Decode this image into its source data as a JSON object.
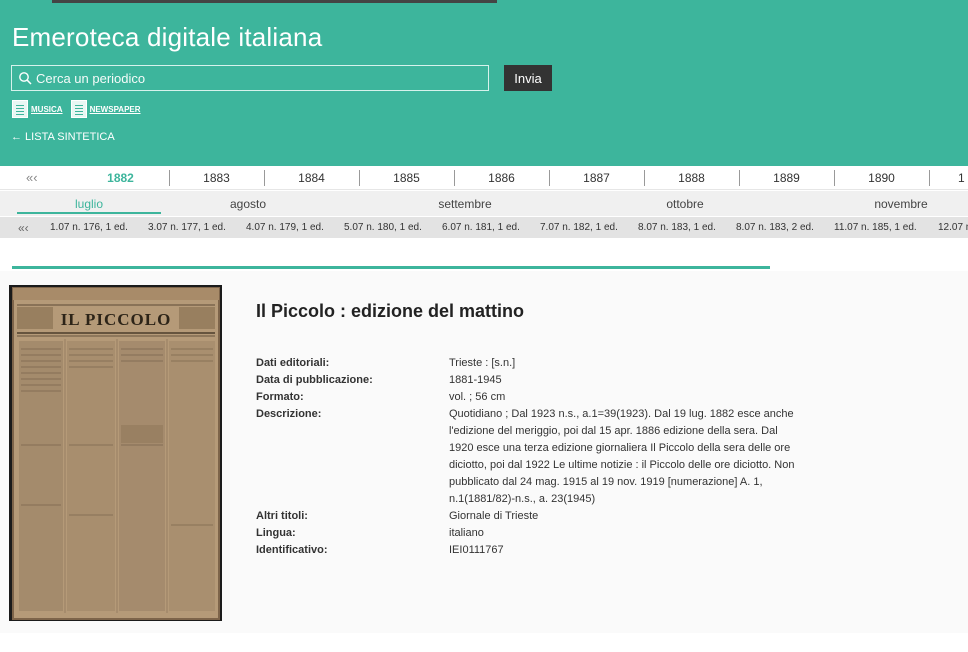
{
  "header": {
    "title": "Emeroteca digitale italiana",
    "search_placeholder": "Cerca un periodico",
    "submit_label": "Invia",
    "filters": [
      {
        "label": "MUSICA"
      },
      {
        "label": "NEWSPAPER"
      }
    ],
    "back_link": "← LISTA SINTETICA"
  },
  "years": {
    "prev": "«‹",
    "items": [
      "1882",
      "1883",
      "1884",
      "1885",
      "1886",
      "1887",
      "1888",
      "1889",
      "1890",
      "1"
    ],
    "active": "1882"
  },
  "months": {
    "items": [
      "luglio",
      "agosto",
      "settembre",
      "ottobre",
      "novembre"
    ],
    "active": "luglio"
  },
  "issues": {
    "prev": "«‹",
    "items": [
      "1.07 n. 176, 1 ed.",
      "3.07 n. 177, 1 ed.",
      "4.07 n. 179, 1 ed.",
      "5.07 n. 180, 1 ed.",
      "6.07 n. 181, 1 ed.",
      "7.07 n. 182, 1 ed.",
      "8.07 n. 183, 1 ed.",
      "8.07 n. 183, 2 ed.",
      "11.07 n. 185, 1 ed.",
      "12.07 n"
    ]
  },
  "record": {
    "thumbnail_masthead": "IL PICCOLO",
    "title": "Il Piccolo : edizione del mattino",
    "fields": [
      {
        "label": "Dati editoriali:",
        "value": "Trieste : [s.n.]"
      },
      {
        "label": "Data di pubblicazione:",
        "value": "1881-1945"
      },
      {
        "label": "Formato:",
        "value": "vol. ; 56 cm"
      },
      {
        "label": "Descrizione:",
        "value": "Quotidiano ; Dal 1923 n.s., a.1=39(1923). Dal 19 lug. 1882 esce anche l'edizione del meriggio, poi dal 15 apr. 1886 edizione della sera. Dal 1920 esce una terza edizione giornaliera Il Piccolo della sera delle ore diciotto, poi dal 1922 Le ultime notizie : il Piccolo delle ore diciotto. Non pubblicato dal 24 mag. 1915 al 19 nov. 1919 [numerazione] A. 1, n.1(1881/82)-n.s., a. 23(1945)"
      },
      {
        "label": "Altri titoli:",
        "value": "Giornale di Trieste"
      },
      {
        "label": "Lingua:",
        "value": "italiano"
      },
      {
        "label": "Identificativo:",
        "value": "IEI0111767"
      }
    ]
  },
  "colors": {
    "accent": "#3db59c",
    "button_dark": "#333333"
  }
}
